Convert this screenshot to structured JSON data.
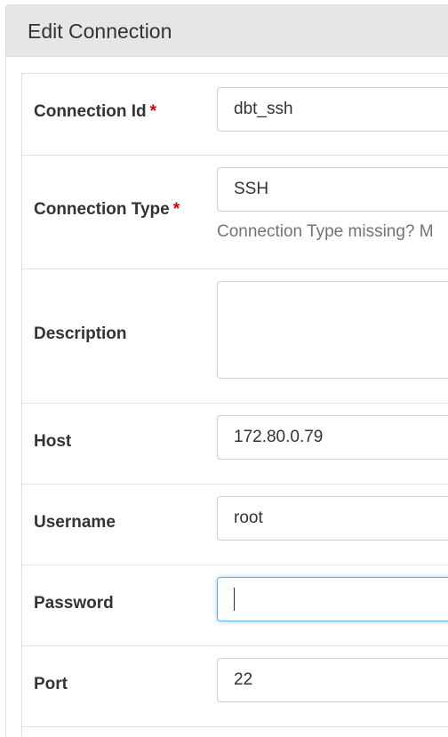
{
  "panel": {
    "title": "Edit Connection"
  },
  "required_marker": "*",
  "fields": {
    "conn_id": {
      "label": "Connection Id",
      "value": "dbt_ssh"
    },
    "conn_type": {
      "label": "Connection Type",
      "value": "SSH",
      "help": "Connection Type missing? M"
    },
    "description": {
      "label": "Description",
      "value": ""
    },
    "host": {
      "label": "Host",
      "value": "172.80.0.79"
    },
    "username": {
      "label": "Username",
      "value": "root"
    },
    "password": {
      "label": "Password",
      "value": ""
    },
    "port": {
      "label": "Port",
      "value": "22"
    }
  }
}
